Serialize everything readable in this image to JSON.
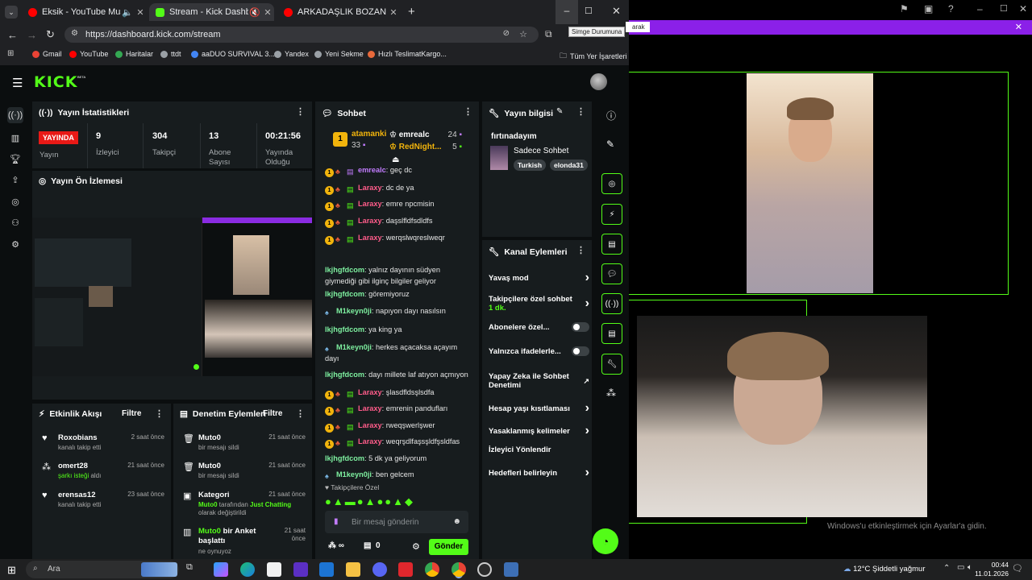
{
  "browser": {
    "tabs": [
      {
        "title": "Eksik - YouTube Music",
        "color": "#ff0000"
      },
      {
        "title": "Stream - Kick Dashboard",
        "color": "#53fc18"
      },
      {
        "title": "ARKADAŞLIK BOZAN VAMPİR K",
        "color": "#ff0000"
      }
    ],
    "new_tab": "+",
    "url": "https://dashboard.kick.com/stream",
    "tooltip": "Simge Durumuna",
    "bookmarks": [
      "Gmail",
      "YouTube",
      "Haritalar",
      "ttdt",
      "aaDUO SURVIVAL 3...",
      "Yandex",
      "Yeni Sekme",
      "Hızlı TeslimatKargo..."
    ],
    "all_bookmarks": "Tüm Yer İşaretleri"
  },
  "kick": {
    "logo": "KICK",
    "beta": "BETA",
    "stats": {
      "title": "Yayın İstatistikleri",
      "live_badge": "YAYINDA",
      "live_label": "Yayın",
      "items": [
        {
          "value": "9",
          "label": "İzleyici"
        },
        {
          "value": "304",
          "label": "Takipçi"
        },
        {
          "value": "13",
          "label": "Abone Sayısı"
        },
        {
          "value": "00:21:56",
          "label": "Yayında Olduğu"
        }
      ]
    },
    "preview_title": "Yayın Ön İzlemesi",
    "chat": {
      "title": "Sohbet",
      "top": [
        {
          "rank": "1",
          "name": "atamanki",
          "count": "33"
        },
        {
          "name": "emrealc",
          "count": "24"
        },
        {
          "name": "RedNight...",
          "count": "5"
        }
      ],
      "messages": [
        {
          "user": "emrealc",
          "text": ": geç dc",
          "color": "#c27cff",
          "badges": true
        },
        {
          "user": "Laraxy",
          "text": ": dc de ya",
          "color": "#ff5c8a",
          "badges": true
        },
        {
          "user": "Laraxy",
          "text": ": emre npcmisin",
          "color": "#ff5c8a",
          "badges": true
        },
        {
          "user": "Laraxy",
          "text": ": daşslfldfsdldfs",
          "color": "#ff5c8a",
          "badges": true
        },
        {
          "user": "Laraxy",
          "text": ": werqslwqreslweqr",
          "color": "#ff5c8a",
          "badges": true
        },
        {
          "user": "lkjhgfdcom",
          "text": ": yalnız dayının südyen giymediği gibi ilginç bilgiler geliyor",
          "color": "#7ef0a0",
          "badges": false
        },
        {
          "user": "lkjhgfdcom",
          "text": ": göremiyoruz",
          "color": "#7ef0a0",
          "badges": false
        },
        {
          "user": "M1keyn0ji",
          "text": ": napıyon dayı nasılsın",
          "color": "#7ef0a0",
          "badges": false,
          "mod": true
        },
        {
          "user": "lkjhgfdcom",
          "text": ": ya king ya",
          "color": "#7ef0a0",
          "badges": false
        },
        {
          "user": "M1keyn0ji",
          "text": ": herkes açacaksa açayım dayı",
          "color": "#7ef0a0",
          "badges": false,
          "mod": true
        },
        {
          "user": "lkjhgfdcom",
          "text": ": dayı millete laf atıyon açmıyon",
          "color": "#7ef0a0",
          "badges": false
        },
        {
          "user": "Laraxy",
          "text": ": şlasdfldsşlsdfa",
          "color": "#ff5c8a",
          "badges": true
        },
        {
          "user": "Laraxy",
          "text": ": emrenin pandufları",
          "color": "#ff5c8a",
          "badges": true
        },
        {
          "user": "Laraxy",
          "text": ": rweqşwerlşwer",
          "color": "#ff5c8a",
          "badges": true
        },
        {
          "user": "Laraxy",
          "text": ": weqrşdlfaşsşldfşsldfas",
          "color": "#ff5c8a",
          "badges": true
        },
        {
          "user": "lkjhgfdcom",
          "text": ": 5 dk ya geliyorum",
          "color": "#7ef0a0",
          "badges": false
        },
        {
          "user": "M1keyn0ji",
          "text": ": ben gelcem",
          "color": "#7ef0a0",
          "badges": false,
          "mod": true
        }
      ],
      "followers_only": "Takipçilere Özel",
      "placeholder": "Bir mesaj gönderin",
      "send": "Gönder",
      "infinity": "∞",
      "count": "0"
    },
    "info": {
      "title": "Yayın bilgisi",
      "stream_title": "fırtınadayım",
      "category": "Sadece Sohbet",
      "tags": [
        "Turkish",
        "elonda31"
      ]
    },
    "actions": {
      "title": "Kanal Eylemleri",
      "items": [
        {
          "label": "Yavaş mod",
          "type": "chevron"
        },
        {
          "label": "Takipçilere özel sohbet",
          "sub": "1 dk.",
          "type": "chevron"
        },
        {
          "label": "Abonelere özel...",
          "type": "toggle"
        },
        {
          "label": "Yalnızca ifadelerle...",
          "type": "toggle"
        },
        {
          "label": "Yapay Zeka ile Sohbet Denetimi",
          "type": "ext"
        },
        {
          "label": "Hesap yaşı kısıtlaması",
          "type": "chevron"
        },
        {
          "label": "Yasaklanmış kelimeler",
          "type": "chevron"
        },
        {
          "label": "İzleyici Yönlendir",
          "type": "none"
        },
        {
          "label": "Hedefleri belirleyin",
          "type": "chevron"
        }
      ]
    },
    "activity": {
      "title": "Etkinlik Akışı",
      "filter": "Filtre",
      "items": [
        {
          "name": "Roxobians",
          "desc": "kanalı takip etti",
          "time": "2 saat önce"
        },
        {
          "name": "omert28",
          "desc_hl": "şarkı isteği",
          "desc": " aldı",
          "time": "21 saat önce"
        },
        {
          "name": "erensas12",
          "desc": "kanalı takip etti",
          "time": "23 saat önce"
        }
      ]
    },
    "moderation": {
      "title": "Denetim Eylemleri",
      "filter": "Filtre",
      "items": [
        {
          "name": "Muto0",
          "desc": "bir mesajı sildi",
          "time": "21 saat önce"
        },
        {
          "name": "Muto0",
          "desc": "bir mesajı sildi",
          "time": "21 saat önce"
        },
        {
          "name": "Kategori",
          "desc_a": "Muto0",
          "desc_b": " tarafından ",
          "desc_c": "Just Chatting",
          "desc_d": " olarak değiştirildi",
          "time": "21 saat önce"
        },
        {
          "name": "Muto0",
          "name2": " bir Anket başlattı",
          "desc": "ne oynuyoz",
          "time": "21 saat önce"
        }
      ]
    }
  },
  "overlay": {
    "banner_text": "arak",
    "watermark": "Windows'u etkinleştirmek için Ayarlar'a gidin."
  },
  "taskbar": {
    "search": "Ara",
    "weather": "12°C  Şiddetli yağmur",
    "time": "00:44",
    "date": "11.01.2026"
  }
}
